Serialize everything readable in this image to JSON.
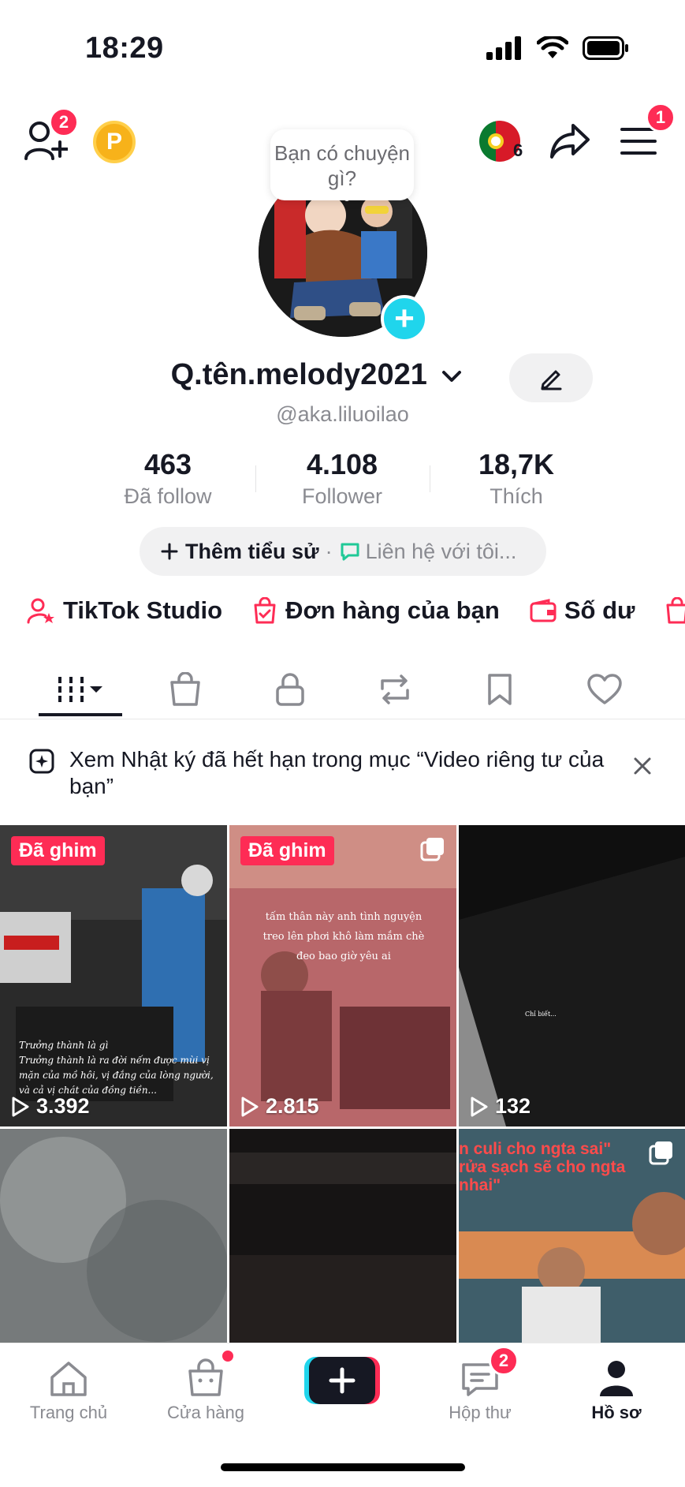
{
  "status_bar": {
    "time": "18:29"
  },
  "top_nav": {
    "friends_badge": "2",
    "coin_letter": "P",
    "streak_count": "6",
    "menu_badge": "1",
    "story_bubble": "Bạn có chuyện gì?"
  },
  "profile": {
    "username": "Q.tên.melody2021",
    "handle": "@aka.liluoilao",
    "stats": [
      {
        "value": "463",
        "label": "Đã follow"
      },
      {
        "value": "4.108",
        "label": "Follower"
      },
      {
        "value": "18,7K",
        "label": "Thích"
      }
    ],
    "bio_add": "Thêm tiểu sử",
    "bio_sep": "·",
    "bio_contact": "Liên hệ với tôi..."
  },
  "shortcuts": [
    {
      "label": "TikTok Studio"
    },
    {
      "label": "Đơn hàng của bạn"
    },
    {
      "label": "Số dư"
    }
  ],
  "notice": {
    "text": "Xem Nhật ký đã hết hạn trong mục “Video riêng tư của bạn”"
  },
  "videos": [
    {
      "pinned": "Đã ghim",
      "views": "3.392",
      "caption": "Trưởng thành là gì\nTrưởng thành là ra đời nếm được mùi vị\nmặn của mồ hôi, vị đắng của lòng người,\nvà cả vị chát của đồng tiền..."
    },
    {
      "pinned": "Đã ghim",
      "views": "2.815",
      "caption": "tấm thân này anh tình nguyện\ntreo lên phơi khô làm mắm chè\nđeo bao giờ yêu ai"
    },
    {
      "views": "132",
      "caption": "Chỉ biết..."
    },
    {},
    {},
    {
      "caption": "n culi cho ngta sai\"\nrửa sạch sẽ cho ngta\nnhai\""
    }
  ],
  "bottom_nav": {
    "home": "Trang chủ",
    "shop": "Cửa hàng",
    "inbox": "Hộp thư",
    "inbox_badge": "2",
    "profile": "Hồ sơ"
  },
  "colors": {
    "accent": "#fe2c55",
    "cyan": "#20d5ec",
    "text": "#161823",
    "muted": "#8a8b91"
  }
}
